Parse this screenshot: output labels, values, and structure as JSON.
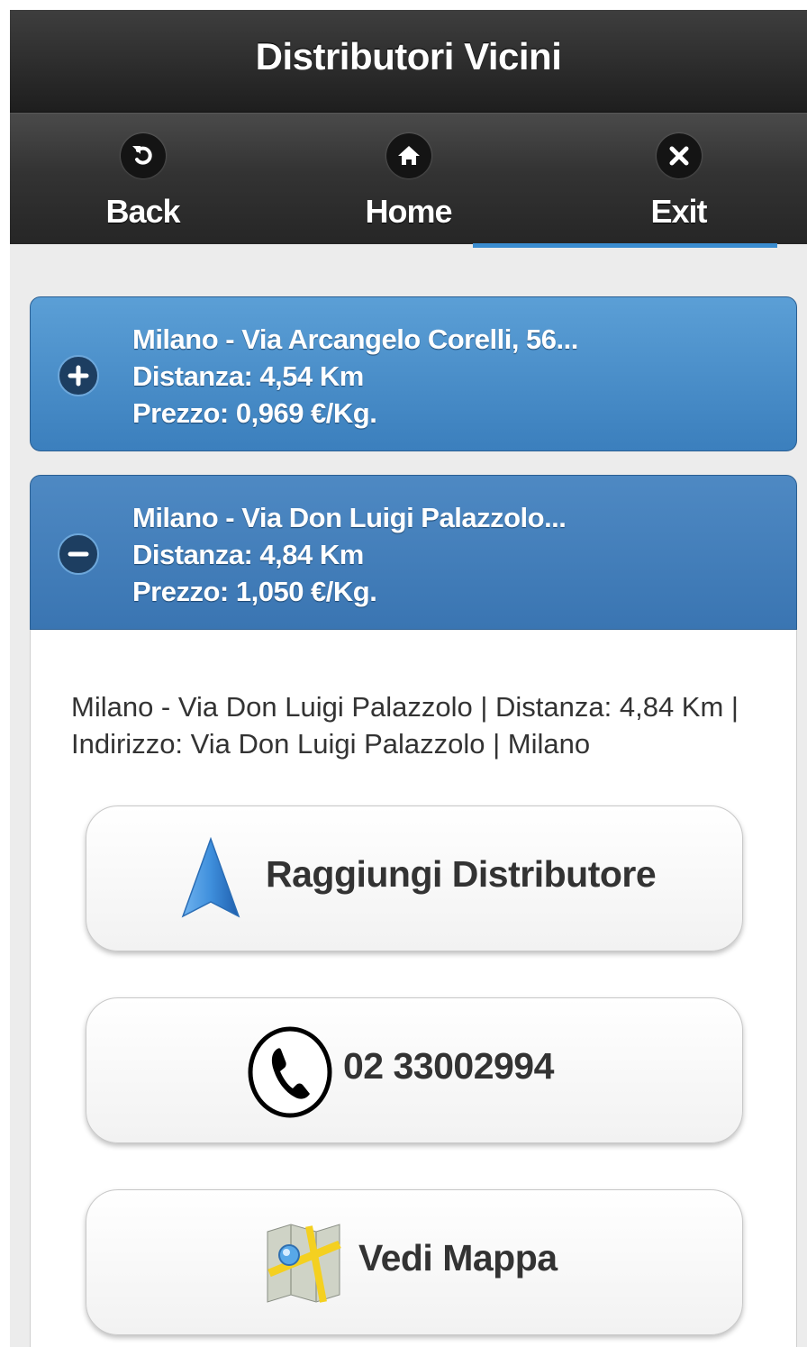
{
  "header": {
    "title": "Distributori Vicini"
  },
  "navbar": {
    "items": [
      {
        "label": "Back",
        "icon": "back-arrow-icon"
      },
      {
        "label": "Home",
        "icon": "home-icon"
      },
      {
        "label": "Exit",
        "icon": "close-icon"
      }
    ]
  },
  "stations": [
    {
      "title": "Milano - Via Arcangelo Corelli, 56...",
      "distance": "Distanza: 4,54 Km",
      "price": "Prezzo: 0,969 €/Kg.",
      "expanded": false,
      "icon": "plus-icon"
    },
    {
      "title": "Milano - Via Don Luigi Palazzolo...",
      "distance": "Distanza: 4,84 Km",
      "price": "Prezzo: 1,050 €/Kg.",
      "expanded": true,
      "icon": "minus-icon"
    }
  ],
  "detail": {
    "description": "Milano - Via Don Luigi Palazzolo | Distanza: 4,84 Km | Indirizzo: Via Don Luigi Palazzolo | Milano",
    "buttons": {
      "navigate": "Raggiungi Distributore",
      "phone": "02 33002994",
      "map": "Vedi Mappa"
    }
  },
  "colors": {
    "header_bg": "#2a2a2a",
    "accent": "#3b7fbd",
    "active_tab": "#3a8cd0"
  }
}
